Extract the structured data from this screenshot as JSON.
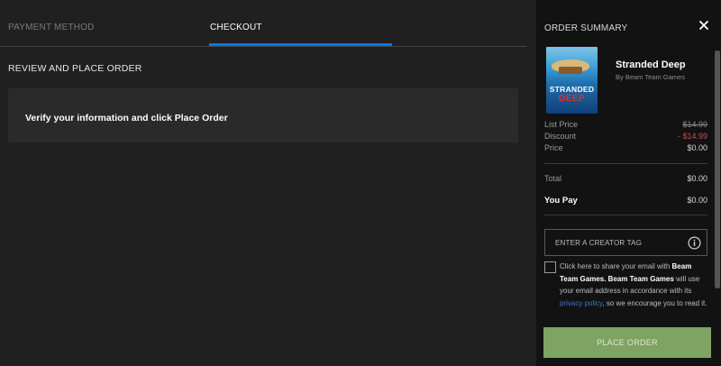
{
  "tabs": {
    "payment_method": "PAYMENT METHOD",
    "checkout": "CHECKOUT",
    "active": "checkout"
  },
  "review": {
    "heading": "REVIEW AND PLACE ORDER",
    "verify_text": "Verify your information and click Place Order"
  },
  "summary": {
    "title": "ORDER SUMMARY",
    "close_icon": "close-icon",
    "product": {
      "cover_word_1": "STRANDED",
      "cover_word_2": "DEEP",
      "name": "Stranded Deep",
      "developer": "By Beam Team Games"
    },
    "rows": {
      "list_price_label": "List Price",
      "list_price_value": "$14.99",
      "discount_label": "Discount",
      "discount_value": "- $14.99",
      "price_label": "Price",
      "price_value": "$0.00",
      "total_label": "Total",
      "total_value": "$0.00",
      "you_pay_label": "You Pay",
      "you_pay_value": "$0.00"
    },
    "creator_tag": {
      "placeholder": "ENTER A CREATOR TAG",
      "icon": "info-icon"
    },
    "consent": {
      "part1": "Click here to share your email with",
      "company_1": "Beam Team Games",
      "separator": ". ",
      "company_2": "Beam Team Games",
      "part2": " will use your email address in accordance with its ",
      "link": "privacy policy",
      "part3": ", so we encourage you to read it."
    },
    "place_order_label": "PLACE ORDER"
  },
  "colors": {
    "accent": "#0078f2",
    "place_order": "#7fa362",
    "discount": "#c0504a",
    "background_main": "#202020",
    "background_summary": "#121212"
  }
}
